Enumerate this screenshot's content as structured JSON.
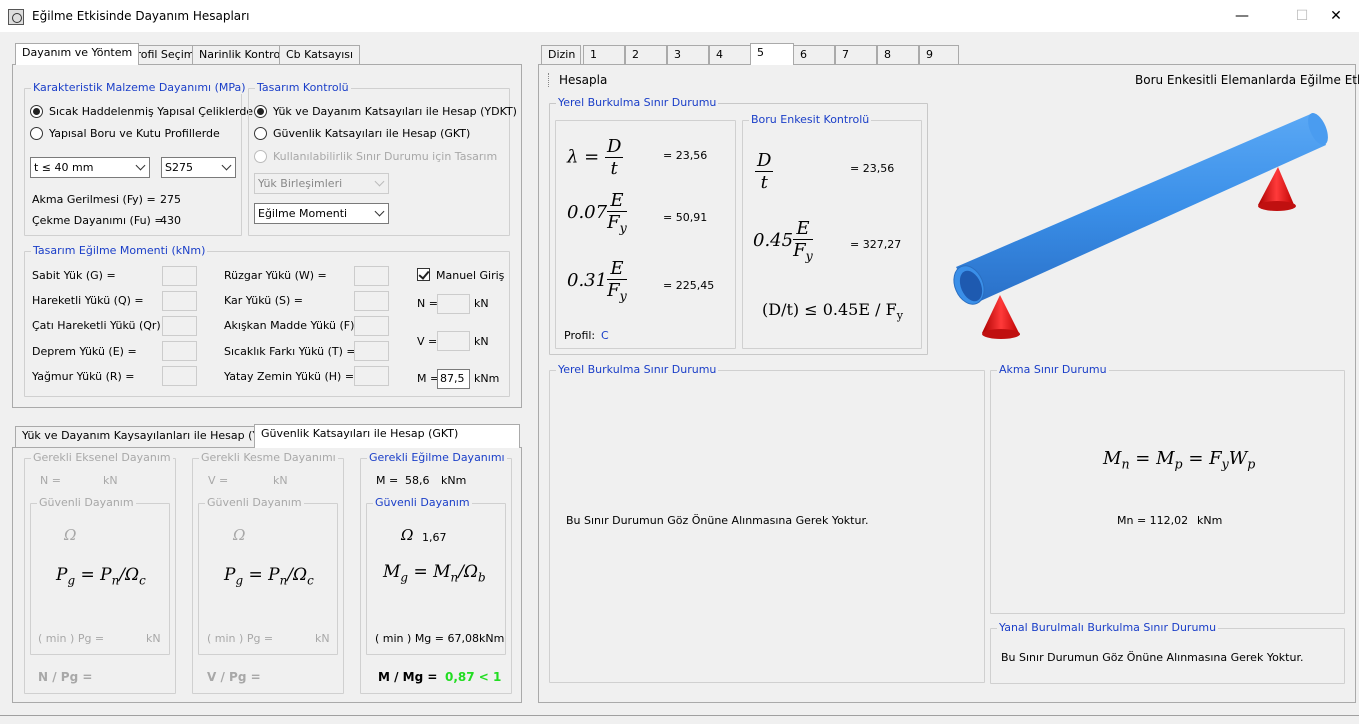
{
  "window": {
    "title": "Eğilme Etkisinde Dayanım Hesapları",
    "minimize": "—",
    "maximize": "☐",
    "close": "✕"
  },
  "left_tabs": [
    "Dayanım ve Yöntem",
    "Profil Seçimi",
    "Narinlik Kontrolü",
    "Cb Katsayısı"
  ],
  "material": {
    "title": "Karakteristik Malzeme Dayanımı (MPa)",
    "option1": "Sıcak Haddelenmiş Yapısal Çeliklerde",
    "option2": "Yapısal Boru ve Kutu Profillerde",
    "thickness": "t ≤ 40 mm",
    "grade": "S275",
    "fy_label": "Akma Gerilmesi (Fy) =",
    "fy_value": "275",
    "fu_label": "Çekme Dayanımı (Fu) =",
    "fu_value": "430"
  },
  "design_control": {
    "title": "Tasarım Kontrolü",
    "option1": "Yük ve Dayanım Katsayıları ile Hesap (YDKT)",
    "option2": "Güvenlik Katsayıları ile Hesap (GKT)",
    "option3": "Kullanılabilirlik Sınır Durumu için Tasarım",
    "combo1": "Yük Birleşimleri",
    "combo2": "Eğilme Momenti"
  },
  "moment": {
    "title": "Tasarım Eğilme Momenti (kNm)",
    "left_labels": [
      "Sabit Yük (G) =",
      "Hareketli Yükü (Q) =",
      "Çatı Hareketli Yükü (Qr) =",
      "Deprem Yükü (E) =",
      "Yağmur Yükü (R) ="
    ],
    "mid_labels": [
      "Rüzgar Yükü (W) =",
      "Kar Yükü (S) =",
      "Akışkan Madde Yükü (F) =",
      "Sıcaklık Farkı Yükü (T) =",
      "Yatay Zemin Yükü (H) ="
    ],
    "manual": "Manuel Giriş",
    "n_label": "N =",
    "n_unit": "kN",
    "v_label": "V =",
    "v_unit": "kN",
    "m_label": "M =",
    "m_value": "87,5",
    "m_unit": "kNm"
  },
  "bottom_tabs": [
    "Yük ve Dayanım Kaysayılanları ile Hesap (YDKT)",
    "Güvenlik Katsayıları ile Hesap (GKT)"
  ],
  "axial": {
    "title": "Gerekli Eksenel Dayanım",
    "n_label": "N =",
    "unit": "kN",
    "safe_title": "Güvenli Dayanım",
    "omega": "Ω",
    "formula_lhs": "P",
    "formula_lhs_sub": "g",
    "formula_p": "P",
    "formula_p_sub": "n",
    "formula_om_sub": "c",
    "min_label": "( min ) Pg =",
    "min_unit": "kN",
    "ratio": "N / Pg ="
  },
  "shear": {
    "title": "Gerekli Kesme Dayanımı",
    "v_label": "V =",
    "unit": "kN",
    "safe_title": "Güvenli Dayanım",
    "omega": "Ω",
    "formula_lhs": "P",
    "formula_lhs_sub": "g",
    "formula_p": "P",
    "formula_p_sub": "n",
    "formula_om_sub": "c",
    "min_label": "( min ) Pg =",
    "min_unit": "kN",
    "ratio": "V / Pg ="
  },
  "bending": {
    "title": "Gerekli Eğilme Dayanımı",
    "m_label": "M =",
    "m_value": "58,6",
    "m_unit": "kNm",
    "safe_title": "Güvenli Dayanım",
    "omega": "Ω",
    "omega_value": "1,67",
    "formula_lhs": "M",
    "formula_lhs_sub": "g",
    "formula_p": "M",
    "formula_p_sub": "n",
    "formula_om_sub": "b",
    "min_label": "( min ) Mg = 67,08",
    "min_unit": "kNm",
    "ratio": "M / Mg =",
    "ratio_value": "0,87 < 1",
    "ratio_color": "#22dd22"
  },
  "right_tabs": [
    "Dizin",
    "1",
    "2",
    "3",
    "4",
    "5",
    "6",
    "7",
    "8",
    "9"
  ],
  "toolbar": {
    "calc": "Hesapla",
    "header": "Boru Enkesitli Elemanlarda Eğilme Etkisi"
  },
  "local_buckling": {
    "title": "Yerel Burkulma Sınır Durumu",
    "f1_lhs": "λ =",
    "f1_num": "D",
    "f1_den": "t",
    "f1_value": "=  23,56",
    "f2_coef": "0.07",
    "f2_num": "E",
    "f2_den": "F",
    "f2_den_sub": "y",
    "f2_value": "=  50,91",
    "f3_coef": "0.31",
    "f3_num": "E",
    "f3_den": "F",
    "f3_den_sub": "y",
    "f3_value": "=  225,45",
    "profile_label": "Profil:",
    "profile_value": "C"
  },
  "pipe_check": {
    "title": "Boru Enkesit Kontrolü",
    "f1_num": "D",
    "f1_den": "t",
    "f1_value": "=  23,56",
    "f2_coef": "0.45",
    "f2_num": "E",
    "f2_den": "F",
    "f2_den_sub": "y",
    "f2_value": "=  327,27",
    "cond": "(D/t)  ≤  0.45E  /  F",
    "cond_sub": "y"
  },
  "local_buckling2": {
    "title": "Yerel Burkulma Sınır Durumu",
    "text": "Bu Sınır Durumun Göz Önüne Alınmasına Gerek Yoktur."
  },
  "yield": {
    "title": "Akma Sınır Durumu",
    "formula_a": "M",
    "formula_a_sub": "n",
    "formula_b": "M",
    "formula_b_sub": "p",
    "formula_c": "F",
    "formula_c_sub": "y",
    "formula_d": "W",
    "formula_d_sub": "p",
    "result": "Mn = 112,02",
    "result_unit": "kNm"
  },
  "ltb": {
    "title": "Yanal Burulmalı Burkulma Sınır Durumu",
    "text": "Bu Sınır Durumun Göz Önüne Alınmasına Gerek Yoktur."
  },
  "colors": {
    "accent": "#1a3ec8",
    "pipe": "#3a8fe8",
    "support": "#e02020"
  }
}
